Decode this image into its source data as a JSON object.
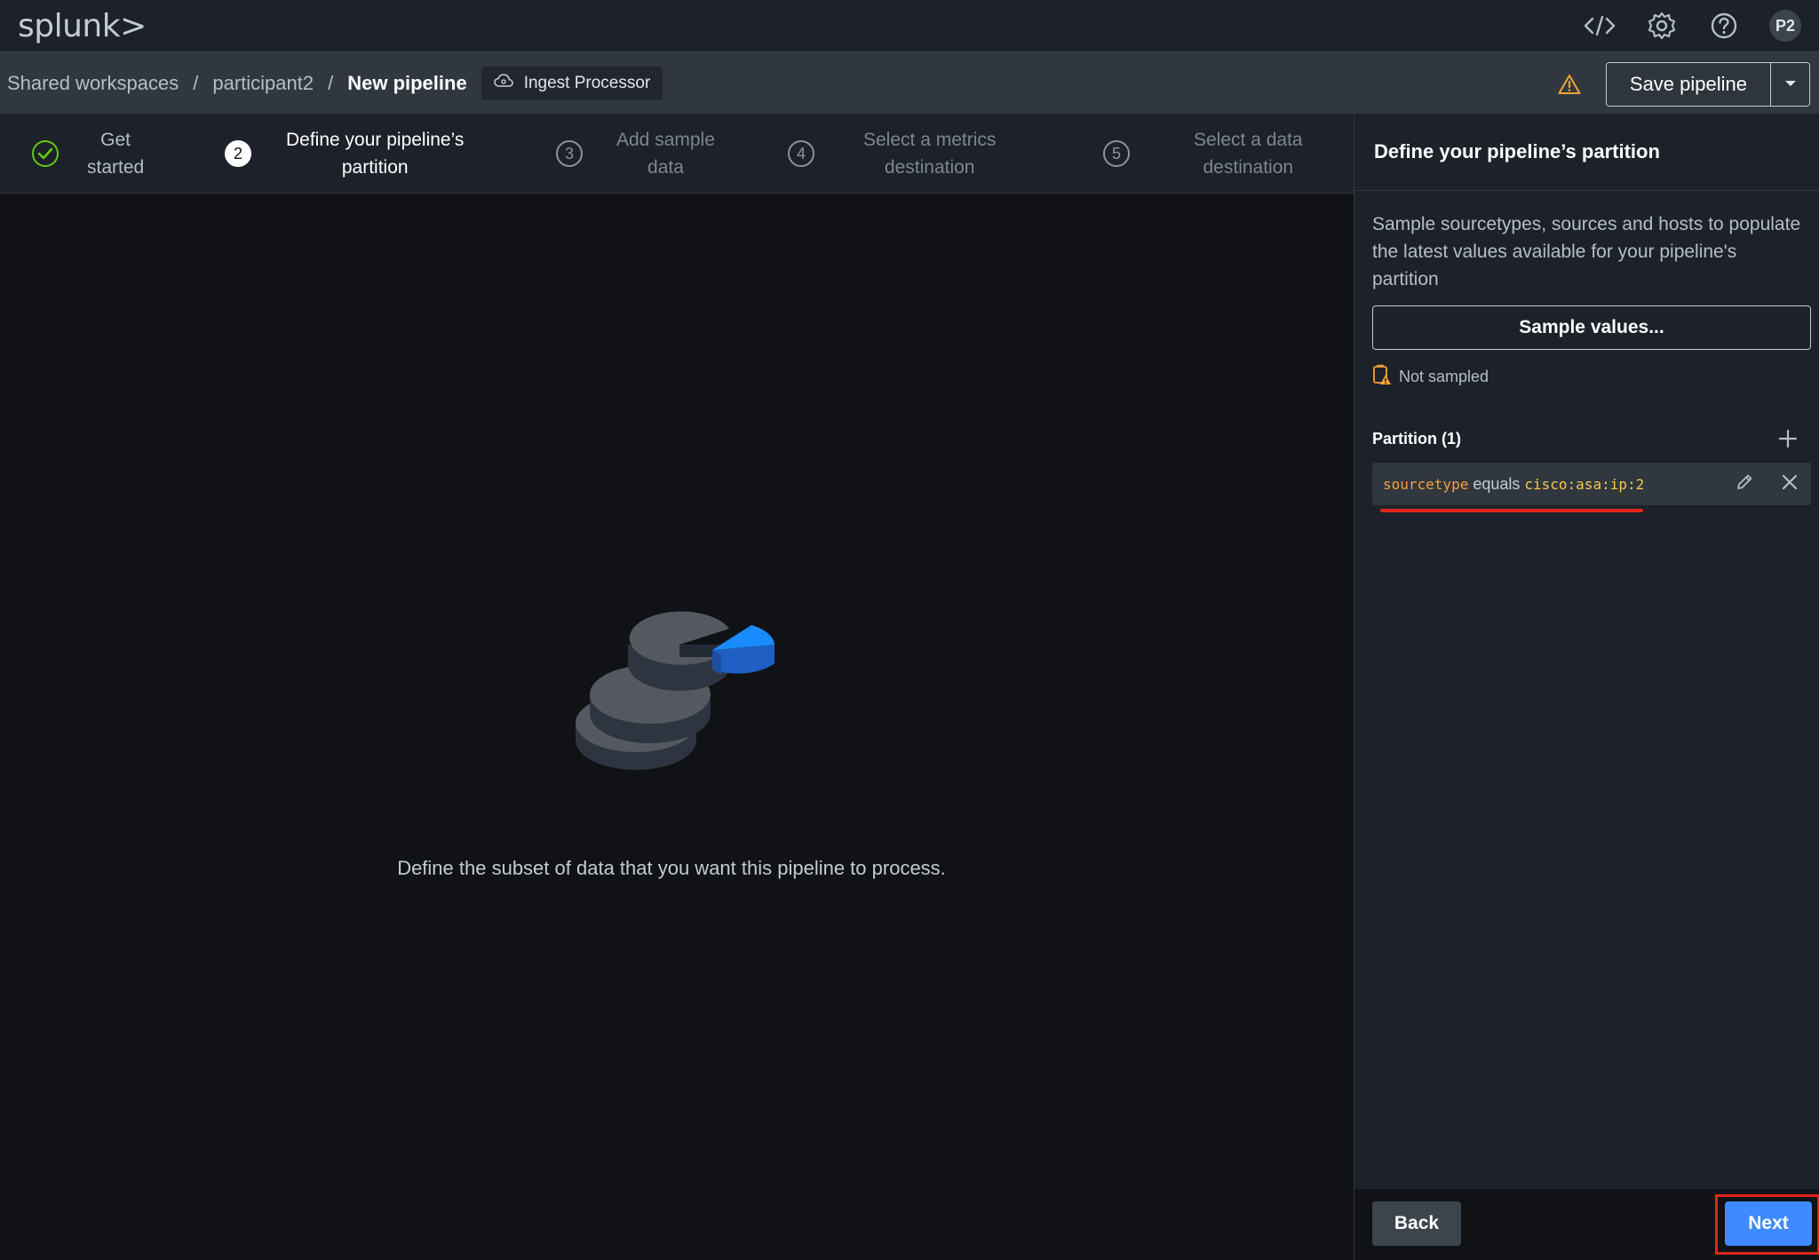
{
  "app": {
    "logo": "splunk>"
  },
  "header": {
    "avatar_initials": "P2"
  },
  "breadcrumb": {
    "items": [
      "Shared workspaces",
      "participant2",
      "New pipeline"
    ],
    "separator": "/",
    "chip_label": "Ingest Processor",
    "save_label": "Save pipeline"
  },
  "stepper": {
    "steps": [
      {
        "number": "",
        "line1": "Get",
        "line2": "started",
        "state": "done"
      },
      {
        "number": "2",
        "line1": "Define your pipeline’s",
        "line2": "partition",
        "state": "active"
      },
      {
        "number": "3",
        "line1": "Add sample",
        "line2": "data",
        "state": "pending"
      },
      {
        "number": "4",
        "line1": "Select a metrics",
        "line2": "destination",
        "state": "pending"
      },
      {
        "number": "5",
        "line1": "Select a data",
        "line2": "destination",
        "state": "pending"
      }
    ]
  },
  "canvas": {
    "empty_text": "Define the subset of data that you want this pipeline to process."
  },
  "panel": {
    "title": "Define your pipeline’s partition",
    "description": "Sample sourcetypes, sources and hosts to populate the latest values available for your pipeline's partition",
    "sample_button": "Sample values...",
    "status": "Not sampled",
    "partition_title": "Partition (1)",
    "partition_rows": [
      {
        "field": "sourcetype",
        "operator": "equals",
        "value": "cisco:asa:ip:2"
      }
    ],
    "back_label": "Back",
    "next_label": "Next"
  },
  "colors": {
    "accent": "#3e8bff",
    "success": "#65c90d",
    "warning": "#f2a33a",
    "highlight": "#e0261a"
  }
}
